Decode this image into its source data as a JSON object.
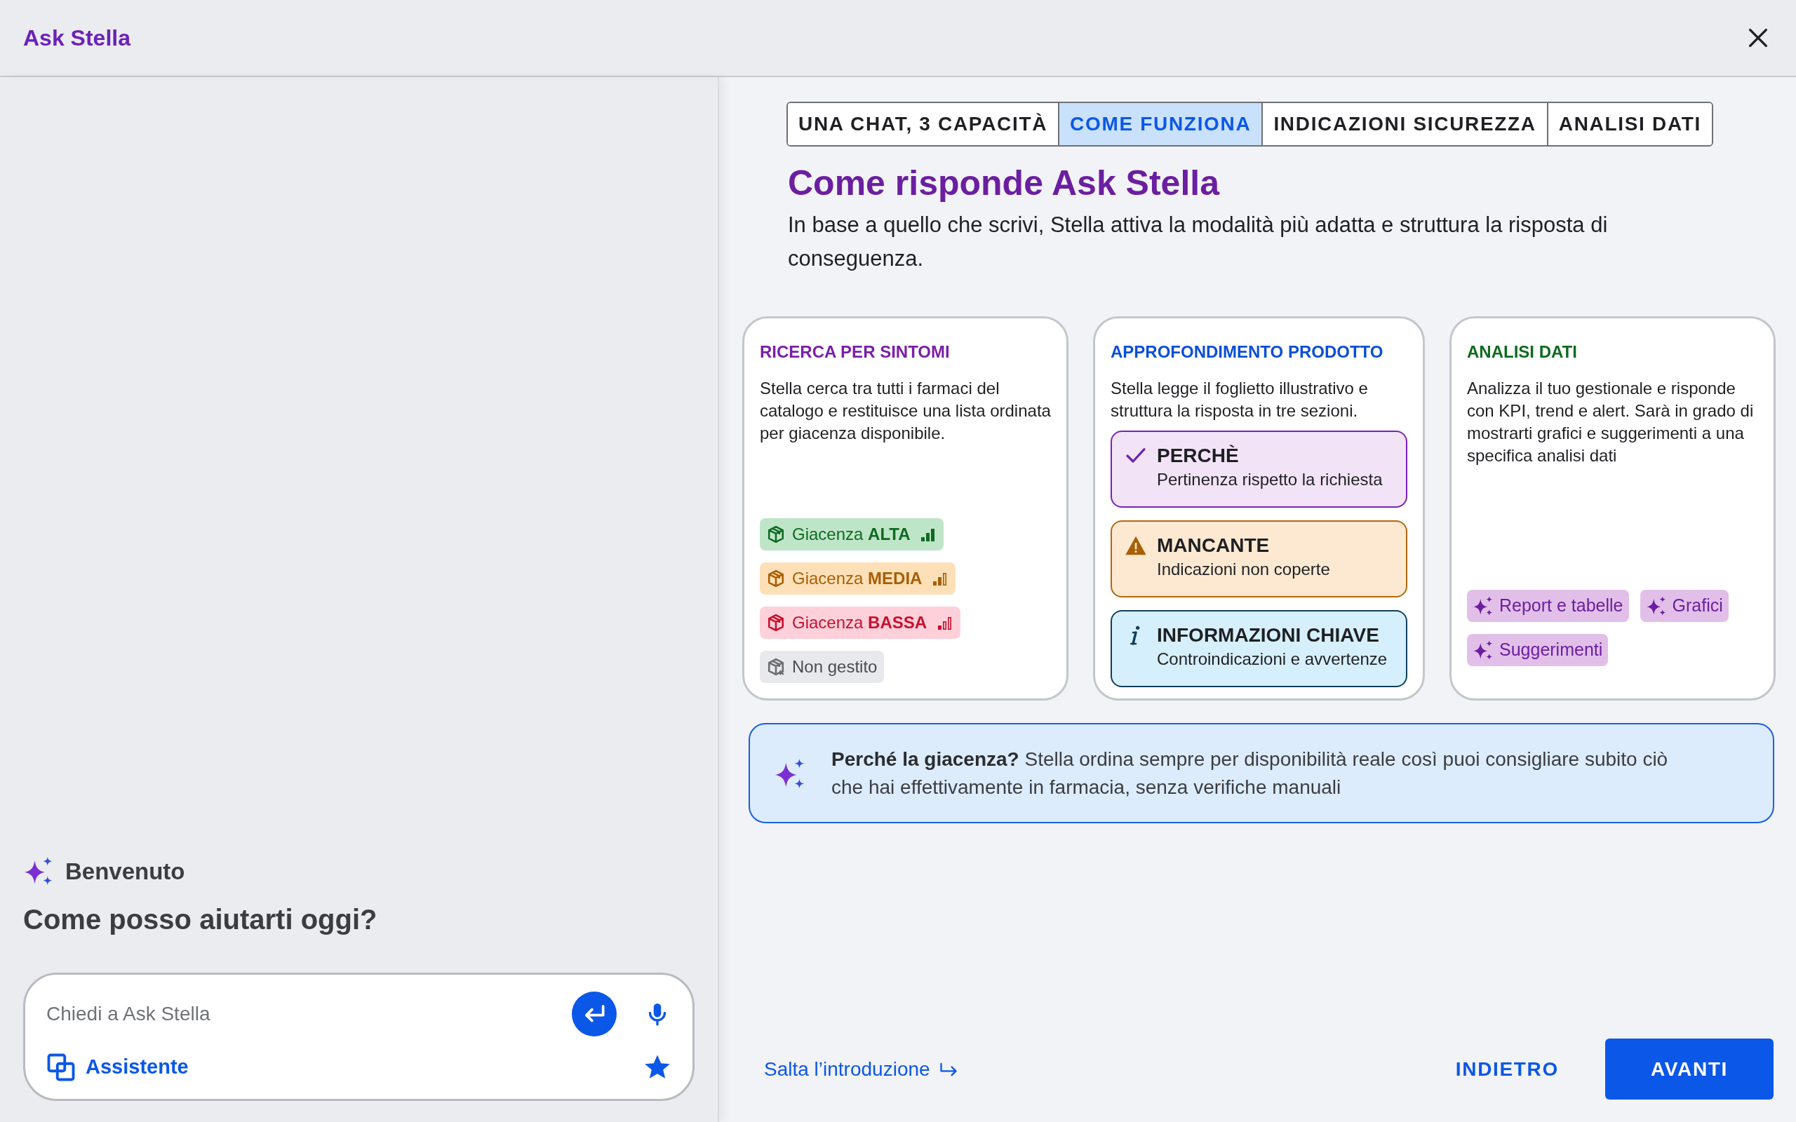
{
  "header": {
    "title": "Ask Stella"
  },
  "chat": {
    "welcome": "Benvenuto",
    "prompt": "Come posso aiutarti oggi?",
    "input": {
      "placeholder": "Chiedi a Ask Stella"
    },
    "mode": "Assistente"
  },
  "tabs": [
    {
      "label": "UNA CHAT, 3 CAPACITÀ",
      "selected": false
    },
    {
      "label": "COME FUNZIONA",
      "selected": true
    },
    {
      "label": "INDICAZIONI SICUREZZA",
      "selected": false
    },
    {
      "label": "ANALISI DATI",
      "selected": false
    }
  ],
  "title": "Come risponde Ask Stella",
  "subtitle": "In base a quello che scrivi, Stella attiva la modalità più adatta e struttura la risposta di conseguenza.",
  "cards": [
    {
      "kind": "stock",
      "title": "RICERCA PER SINTOMI",
      "color": "#7b1fa8",
      "text": "Stella cerca tra tutti i farmaci del catalogo e restituisce una lista ordinata per giacenza disponibile.",
      "badges": [
        {
          "kind": "high",
          "label": "Giacenza **ALTA**"
        },
        {
          "kind": "medium",
          "label": "Giacenza **MEDIA**"
        },
        {
          "kind": "low",
          "label": "Giacenza **BASSA**"
        },
        {
          "kind": "none",
          "label": "Non gestito"
        }
      ]
    },
    {
      "kind": "sections",
      "title": "APPROFONDIMENTO PRODOTTO",
      "color": "#0b4fd8",
      "text": "Stella legge il foglietto illustrativo e struttura la risposta in tre sezioni.",
      "sections": [
        {
          "kind": "check",
          "title": "PERCHÈ",
          "text": "Pertinenza rispetto la richiesta"
        },
        {
          "kind": "warning",
          "title": "MANCANTE",
          "text": "Indicazioni non coperte"
        },
        {
          "kind": "info",
          "title": "INFORMAZIONI CHIAVE",
          "text": "Controindicazioni e avvertenze"
        }
      ]
    },
    {
      "kind": "tags",
      "title": "ANALISI DATI",
      "color": "#0e6b1e",
      "text": "Analizza il tuo gestionale e risponde con KPI, trend e alert. Sarà in grado di mostrarti grafici e suggerimenti a una specifica analisi dati",
      "tags": [
        "Report e tabelle",
        "Grafici",
        "Suggerimenti"
      ]
    }
  ],
  "note": "**Perché la giacenza?** Stella ordina sempre per disponibilità reale così puoi consigliare subito ciò che hai effettivamente in farmacia, senza verifiche manuali",
  "footer": {
    "skip": "Salta l’introduzione",
    "back": "INDIETRO",
    "next": "AVANTI"
  }
}
